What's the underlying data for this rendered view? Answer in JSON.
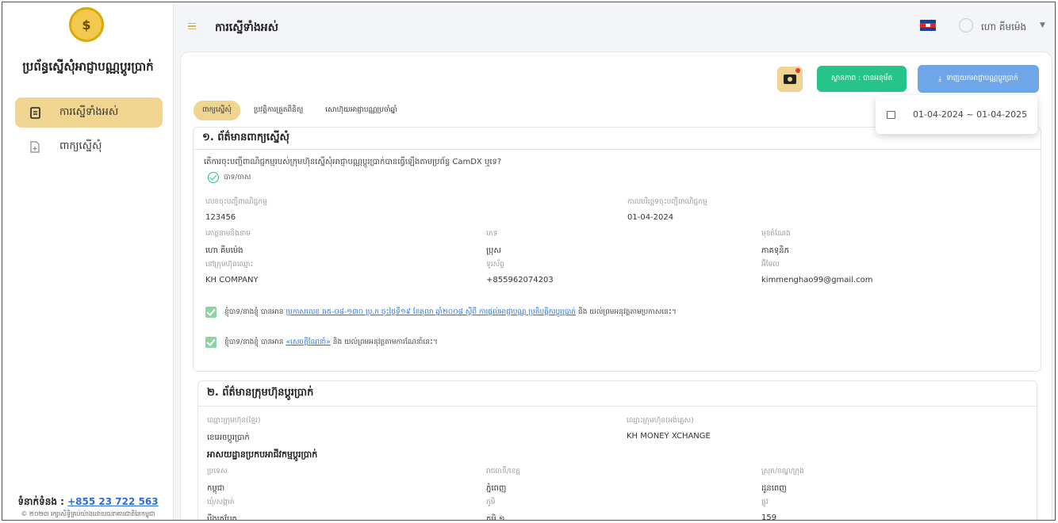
{
  "sidebar": {
    "system_title": "ប្រព័ន្ធស្នើសុំអាជ្ញាបណ្ណប្ដូរប្រាក់",
    "items": [
      {
        "label": "ការស្នើទាំងអស់",
        "icon": "document-icon",
        "active": true
      },
      {
        "label": "ពាក្យស្នើសុំ",
        "icon": "file-add-icon",
        "active": false
      }
    ],
    "contact_label": "ទំនាក់ទំនង : ",
    "contact_phone": "+855 23 722 563",
    "copyright": "© ២០២៣ រក្សាសិទ្ធិគ្រប់យ៉ាងដោយធនាគារជាតិនៃកម្ពុជា"
  },
  "header": {
    "title": "ការស្នើទាំងអស់",
    "user_name": "ហោ គីមម៉េង"
  },
  "toolbar": {
    "status_label": "ស្ថានភាព : បានអនុម័ត",
    "download_label": "ទាញយកអាជ្ញាបណ្ណប្ដូរប្រាក់",
    "date_range": "01-04-2024 ~ 01-04-2025"
  },
  "tabs": [
    {
      "label": "ពាក្យស្នើសុំ",
      "active": true
    },
    {
      "label": "ប្រវត្តិការត្រួតពិនិត្យ",
      "active": false
    },
    {
      "label": "សោហ៊ុយអាជ្ញាបណ្ណប្រចាំឆ្នាំ",
      "active": false
    }
  ],
  "section1": {
    "title": "១. ព័ត៌មានពាក្យស្នើសុំ",
    "question": "តើការចុះបញ្ជីពាណិជ្ជកម្មរបស់ក្រុមហ៊ុនស្នើសុំអាជ្ញាបណ្ណប្ដូរប្រាក់បានធ្វើឡើងតាមប្រព័ន្ធ CamDX ឬទេ?",
    "answer": "បាទ/ចាស",
    "fields": {
      "reg_no_label": "លេខចុះបញ្ជីពាណិជ្ជកម្ម",
      "reg_no": "123456",
      "reg_date_label": "កាលបរិច្ឆេទចុះបញ្ជីពាណិជ្ជកម្ម",
      "reg_date": "01-04-2024",
      "name_label": "គោត្តនាមនិងនាម",
      "name": "ហោ គីមម៉េង",
      "gender_label": "ភេទ",
      "gender": "ប្រុស",
      "position_label": "មុខតំណែង",
      "position": "ភាគទុនិក",
      "company_label": "នៅក្រុមហ៊ុនឈ្មោះ",
      "company": "KH COMPANY",
      "phone_label": "ទូរស័ព្ទ",
      "phone": "+855962074203",
      "email_label": "អ៊ីមែល",
      "email": "kimmenghao99@gmail.com"
    },
    "agree1_prefix": "ខ្ញុំបាទ/នាងខ្ញុំ បានអាន",
    "agree1_link": "ប្រកាសលេខ ធ៥-០៨-១៣០ ប្រ.ក ចុះថ្ងៃទី១៩ ខែតុលា ឆ្នាំ២០០៨ ស្ដីពី ការផ្ដល់អាជ្ញាបណ្ណ ប្រតិបត្តិករប្ដូរប្រាក់",
    "agree1_suffix": "និង យល់ព្រមអនុវត្តតាមប្រកាសនេះ។",
    "agree2_prefix": "ខ្ញុំបាទ/នាងខ្ញុំ បានអាន",
    "agree2_link": "«សេចក្ដីណែនាំ»",
    "agree2_suffix": "និង យល់ព្រមអនុវត្តតាមការណែនាំនេះ។"
  },
  "section2": {
    "title": "២. ព័ត៌មានក្រុមហ៊ុនប្ដូរប្រាក់",
    "fields": {
      "name_kh_label": "ឈ្មោះក្រុមហ៊ុន(ខ្មែរ)",
      "name_kh": "ខេអេចប្ដូរប្រាក់",
      "name_en_label": "ឈ្មោះក្រុមហ៊ុន(អង់គ្លេស)",
      "name_en": "KH MONEY XCHANGE"
    },
    "address_heading": "អាសយដ្ឋានប្រកបអាជីវកម្មប្ដូរប្រាក់",
    "address": {
      "country_label": "ប្រទេស",
      "country": "កម្ពុជា",
      "province_label": "រាជធានី/ខេត្ត",
      "province": "ភ្នំពេញ",
      "district_label": "ស្រុក/ខណ្ឌ/ក្រុង",
      "district": "ដូនពេញ",
      "commune_label": "ឃុំ/សង្កាត់",
      "commune": "បឹងត្របែក",
      "village_label": "ភូមិ",
      "village": "ភូមិ ១",
      "street_label": "ផ្លូវ",
      "street": "159"
    }
  }
}
